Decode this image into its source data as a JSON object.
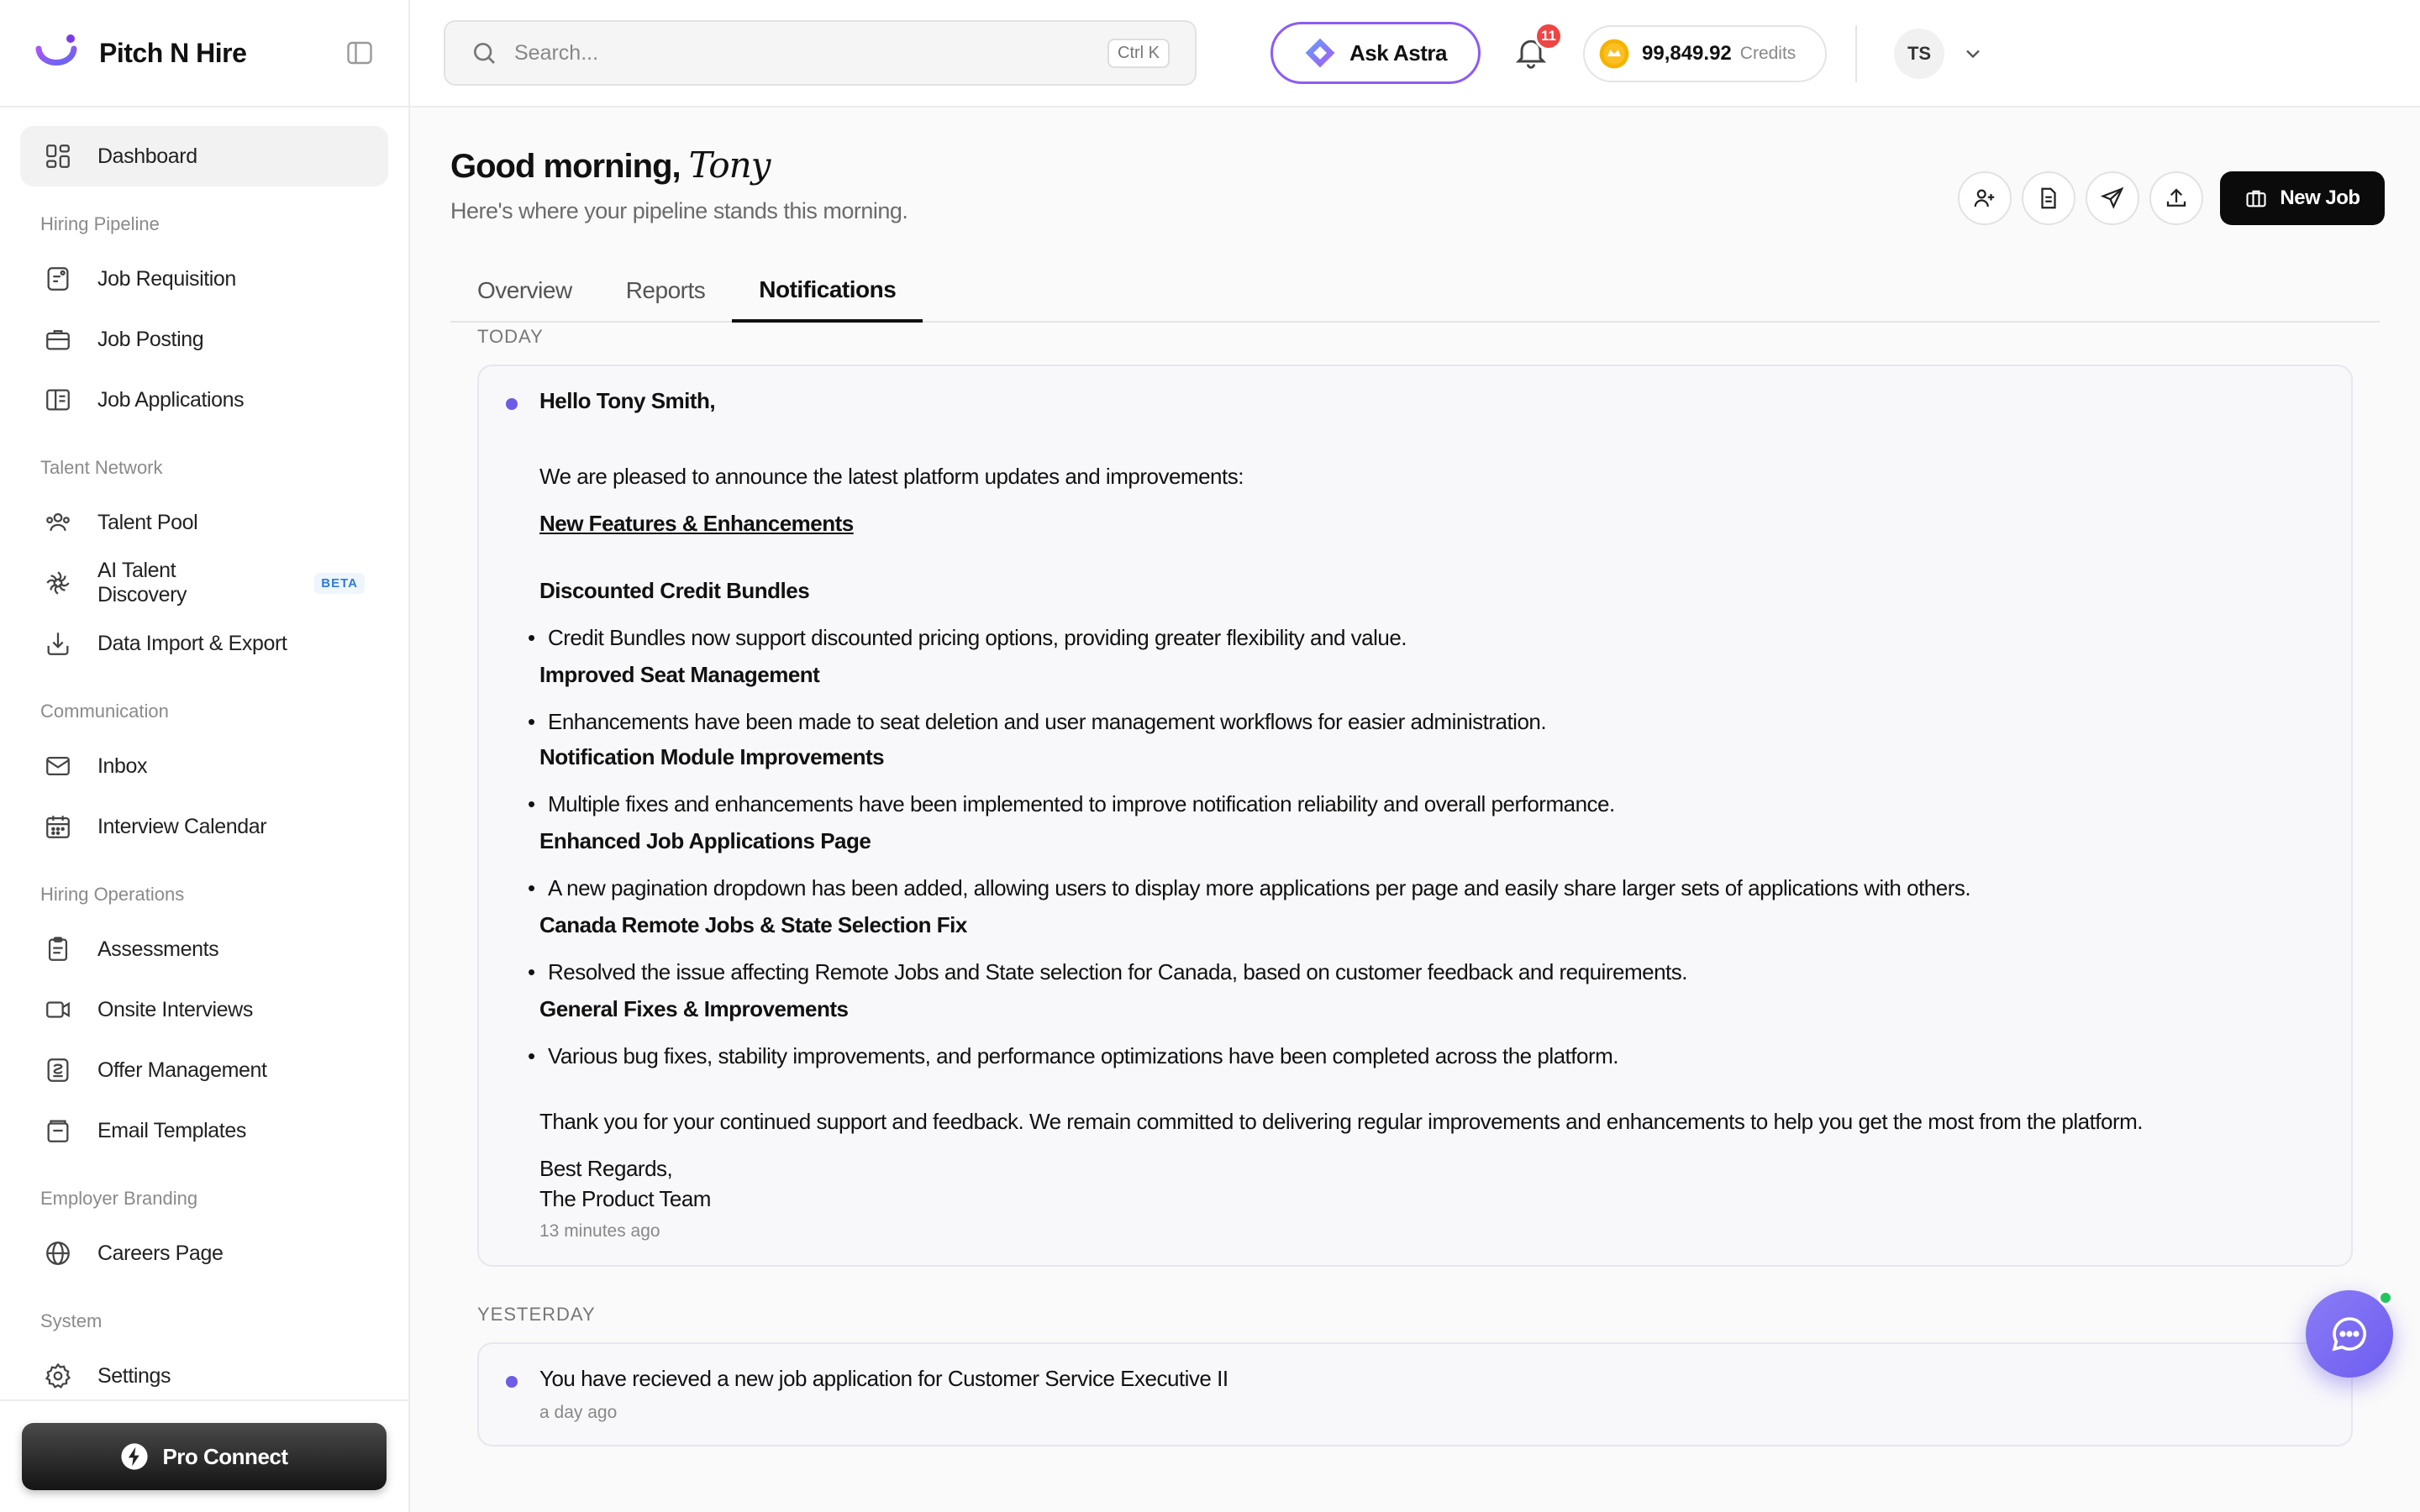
{
  "brand": {
    "name": "Pitch N Hire"
  },
  "sidebar": {
    "dashboard": "Dashboard",
    "sections": [
      {
        "label": "Hiring Pipeline",
        "items": [
          "Job Requisition",
          "Job Posting",
          "Job Applications"
        ]
      },
      {
        "label": "Talent Network",
        "items": [
          "Talent Pool",
          "AI Talent Discovery",
          "Data Import & Export"
        ]
      },
      {
        "label": "Communication",
        "items": [
          "Inbox",
          "Interview Calendar"
        ]
      },
      {
        "label": "Hiring Operations",
        "items": [
          "Assessments",
          "Onsite Interviews",
          "Offer Management",
          "Email Templates"
        ]
      },
      {
        "label": "Employer Branding",
        "items": [
          "Careers Page"
        ]
      },
      {
        "label": "System",
        "items": [
          "Settings"
        ]
      }
    ],
    "beta_badge": "BETA",
    "pro_connect": "Pro Connect"
  },
  "header": {
    "search_placeholder": "Search...",
    "search_shortcut": "Ctrl K",
    "ask_astra": "Ask Astra",
    "notification_count": "11",
    "credits_value": "99,849.92",
    "credits_label": "Credits",
    "avatar_initials": "TS"
  },
  "main": {
    "greeting": "Good morning,",
    "user_name": "Tony",
    "subtitle": "Here's where your pipeline stands this morning.",
    "new_job": "New Job",
    "tabs": [
      "Overview",
      "Reports",
      "Notifications"
    ],
    "active_tab": "Notifications"
  },
  "notifications": {
    "today_label": "TODAY",
    "yesterday_label": "YESTERDAY",
    "today": {
      "greeting": "Hello Tony Smith,",
      "intro": "We are pleased to announce the latest platform updates and improvements:",
      "section_link": "New Features & Enhancements",
      "items": [
        {
          "heading": "Discounted Credit Bundles",
          "bullet": "Credit Bundles now support discounted pricing options, providing greater flexibility and value."
        },
        {
          "heading": "Improved Seat Management",
          "bullet": "Enhancements have been made to seat deletion and user management workflows for easier administration."
        },
        {
          "heading": "Notification Module Improvements",
          "bullet": "Multiple fixes and enhancements have been implemented to improve notification reliability and overall performance."
        },
        {
          "heading": "Enhanced Job Applications Page",
          "bullet": "A new pagination dropdown has been added, allowing users to display more applications per page and easily share larger sets of applications with others."
        },
        {
          "heading": "Canada Remote Jobs & State Selection Fix",
          "bullet": "Resolved the issue affecting Remote Jobs and State selection for Canada, based on customer feedback and requirements."
        },
        {
          "heading": "General Fixes & Improvements",
          "bullet": "Various bug fixes, stability improvements, and performance optimizations have been completed across the platform."
        }
      ],
      "closing": "Thank you for your continued support and feedback. We remain committed to delivering regular improvements and enhancements to help you get the most from the platform.",
      "signoff_1": "Best Regards,",
      "signoff_2": "The Product Team",
      "time": "13 minutes ago"
    },
    "yesterday": {
      "message": "You have recieved a new job application for Customer Service Executive II",
      "time": "a day ago"
    }
  }
}
